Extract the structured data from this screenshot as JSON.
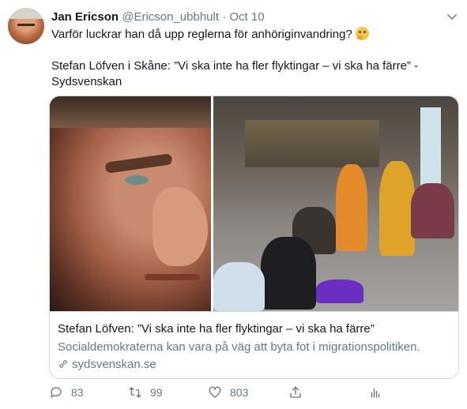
{
  "tweet": {
    "author_name": "Jan Ericson",
    "handle": "@Ericson_ubbhult",
    "separator": "·",
    "date": "Oct 10",
    "text_line1": "Varför luckrar han då upp reglerna för anhöriginvandring?",
    "emoji": "thinking-face",
    "text_line2": "Stefan Löfven i Skåne: ”Vi ska inte ha fler flyktingar – vi ska ha färre” -",
    "text_line3": "Sydsvenskan"
  },
  "card": {
    "title": "Stefan Löfven: ”Vi ska inte ha fler flyktingar – vi ska ha färre”",
    "description": "Socialdemokraterna kan vara på väg att byta fot i migrationspolitiken.",
    "domain": "sydsvenskan.se"
  },
  "actions": {
    "reply_count": "83",
    "retweet_count": "99",
    "like_count": "803"
  },
  "colors": {
    "text": "#14171a",
    "secondary": "#657786",
    "border": "#ccd6dd"
  }
}
